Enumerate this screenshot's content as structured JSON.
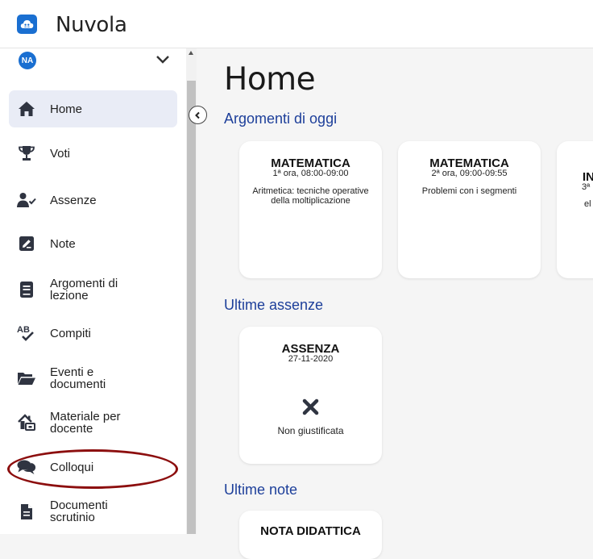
{
  "app": {
    "title": "Nuvola"
  },
  "user": {
    "initials": "NA"
  },
  "sidebar": {
    "items": [
      {
        "label": "Home",
        "icon": "home-icon",
        "active": true
      },
      {
        "label": "Voti",
        "icon": "trophy-icon"
      },
      {
        "label": "Assenze",
        "icon": "user-check-icon"
      },
      {
        "label": "Note",
        "icon": "edit-note-icon"
      },
      {
        "label": "Argomenti di\nlezione",
        "icon": "book-icon"
      },
      {
        "label": "Compiti",
        "icon": "spellcheck-icon"
      },
      {
        "label": "Eventi e\ndocumenti",
        "icon": "folder-open-icon"
      },
      {
        "label": "Materiale per\ndocente",
        "icon": "house-user-icon"
      },
      {
        "label": "Colloqui",
        "icon": "comments-icon"
      },
      {
        "label": "Documenti\nscrutinio",
        "icon": "file-icon"
      }
    ]
  },
  "main": {
    "title": "Home",
    "sections": {
      "topics": {
        "title": "Argomenti di oggi",
        "cards": [
          {
            "subject": "MATEMATICA",
            "time": "1ª ora, 08:00-09:00",
            "description": "Aritmetica: tecniche operative della moltiplicazione"
          },
          {
            "subject": "MATEMATICA",
            "time": "2ª ora, 09:00-09:55",
            "description": "Problemi con i segmenti"
          },
          {
            "subject": "IN",
            "time": "3ª",
            "description": "el"
          }
        ]
      },
      "absences": {
        "title": "Ultime assenze",
        "cards": [
          {
            "type": "ASSENZA",
            "date": "27-11-2020",
            "status": "Non giustificata",
            "icon": "x-icon"
          }
        ]
      },
      "notes": {
        "title": "Ultime note",
        "cards": [
          {
            "type": "NOTA DIDATTICA"
          }
        ]
      }
    }
  },
  "colors": {
    "accent": "#1a6fd1",
    "section_title": "#1d3f9a",
    "active_bg": "#e9ecf6",
    "annotation": "#8c0e0e"
  }
}
